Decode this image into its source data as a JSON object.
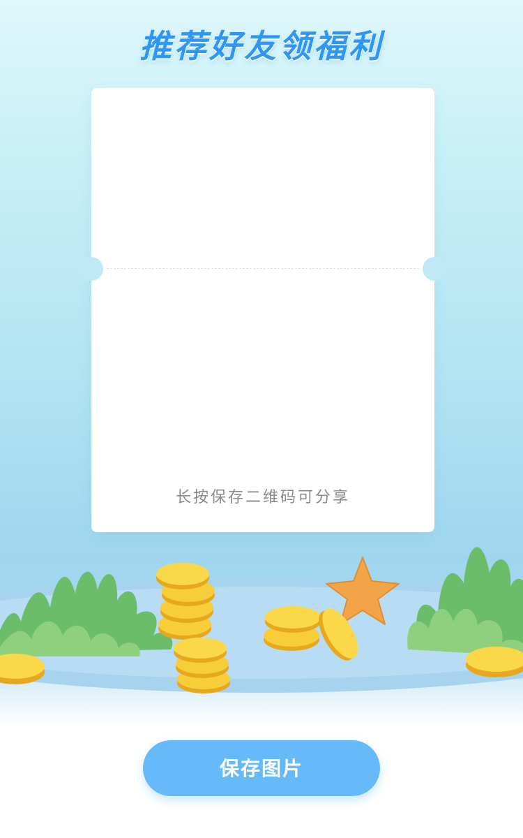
{
  "page": {
    "title": "推荐好友领福利"
  },
  "card": {
    "hint": "长按保存二维码可分享"
  },
  "actions": {
    "save_label": "保存图片"
  },
  "colors": {
    "title": "#2f97f3",
    "button": "#66baf9",
    "hint_text": "#8a8a8a",
    "coin": "#f6c02a",
    "plant": "#6cc16f",
    "starfish": "#f2a548"
  },
  "icons": {
    "decor": [
      "seaweed-icon",
      "coin-stack-icon",
      "starfish-icon"
    ]
  }
}
